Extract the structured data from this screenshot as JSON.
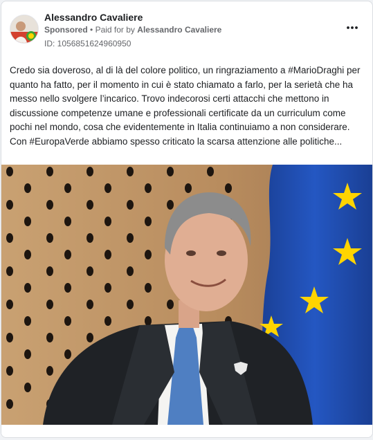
{
  "ad": {
    "page_name": "Alessandro Cavaliere",
    "sponsored_label": "Sponsored",
    "separator": "•",
    "paid_for_prefix": "Paid for by",
    "paid_for_by": "Alessandro Cavaliere",
    "ad_id": "ID: 1056851624960950",
    "menu_icon": "more-horizontal-icon",
    "body_paragraph_1": "Credo sia doveroso, al di là del colore politico, un ringraziamento a #MarioDraghi per quanto ha fatto, per il momento in cui è stato chiamato a farlo, per la serietà che ha messo nello svolgere l’incarico. Trovo indecorosi certi attacchi che mettono in discussione competenze umane e professionali certificate da un curriculum come pochi nel mondo, cosa che evidentemente in Italia continuiamo a non considerare.",
    "body_paragraph_2": "Con #EuropaVerde abbiamo spesso criticato la scarsa attenzione alle politiche..."
  },
  "colors": {
    "text_primary": "#1c1e21",
    "text_secondary": "#65676b",
    "eu_blue": "#1f4fb0",
    "eu_star": "#ffd400",
    "wall": "#c49a6c"
  }
}
